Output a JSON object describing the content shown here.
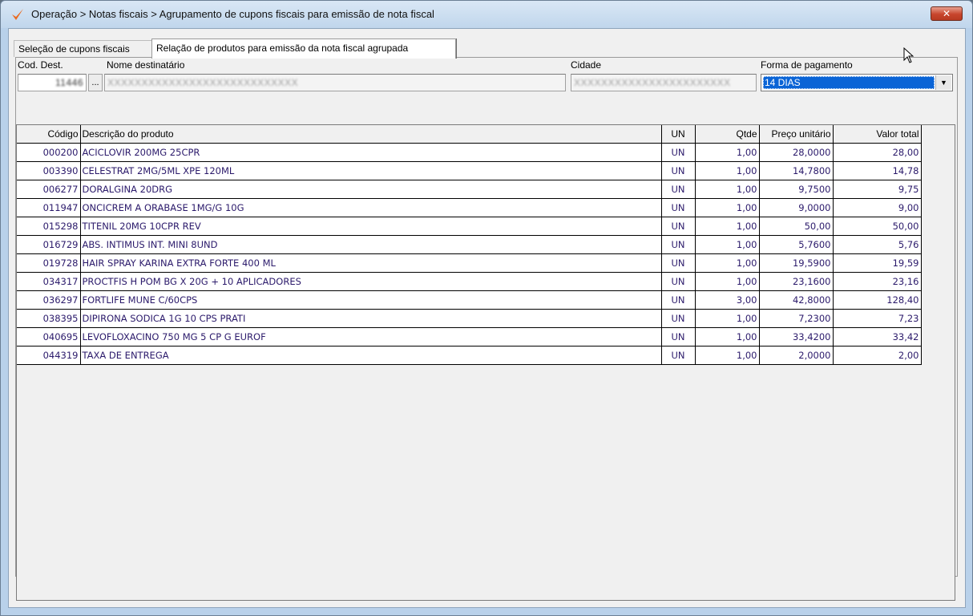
{
  "window": {
    "title": "Operação > Notas fiscais > Agrupamento de cupons fiscais para emissão de nota fiscal",
    "close_label": "✕"
  },
  "tabs": [
    {
      "label": "Seleção de cupons fiscais"
    },
    {
      "label": "Relação de produtos para emissão da nota fiscal agrupada"
    }
  ],
  "form": {
    "cod_dest_label": "Cod. Dest.",
    "cod_dest_value": "11446",
    "nome_label": "Nome destinatário",
    "nome_value": "XXXXXXXXXXXXXXXXXXXXXXXXXXXX",
    "lookup_label": "...",
    "cidade_label": "Cidade",
    "cidade_value": "XXXXXXXXXXXXXXXXXXXXXXX",
    "pagamento_label": "Forma de pagamento",
    "pagamento_value": "14 DIAS"
  },
  "table": {
    "headers": [
      "Código",
      "Descrição do produto",
      "UN",
      "Qtde",
      "Preço unitário",
      "Valor total"
    ],
    "rows": [
      [
        "000200",
        "ACICLOVIR 200MG 25CPR",
        "UN",
        "1,00",
        "28,0000",
        "28,00"
      ],
      [
        "003390",
        "CELESTRAT 2MG/5ML XPE 120ML",
        "UN",
        "1,00",
        "14,7800",
        "14,78"
      ],
      [
        "006277",
        "DORALGINA 20DRG",
        "UN",
        "1,00",
        "9,7500",
        "9,75"
      ],
      [
        "011947",
        "ONCICREM A ORABASE 1MG/G 10G",
        "UN",
        "1,00",
        "9,0000",
        "9,00"
      ],
      [
        "015298",
        "TITENIL 20MG 10CPR REV",
        "UN",
        "1,00",
        "50,00",
        "50,00"
      ],
      [
        "016729",
        "ABS. INTIMUS INT. MINI 8UND",
        "UN",
        "1,00",
        "5,7600",
        "5,76"
      ],
      [
        "019728",
        "HAIR SPRAY KARINA EXTRA FORTE 400 ML",
        "UN",
        "1,00",
        "19,5900",
        "19,59"
      ],
      [
        "034317",
        "PROCTFIS H POM BG X 20G + 10 APLICADORES",
        "UN",
        "1,00",
        "23,1600",
        "23,16"
      ],
      [
        "036297",
        "FORTLIFE MUNE C/60CPS",
        "UN",
        "3,00",
        "42,8000",
        "128,40"
      ],
      [
        "038395",
        "DIPIRONA SODICA 1G 10 CPS PRATI",
        "UN",
        "1,00",
        "7,2300",
        "7,23"
      ],
      [
        "040695",
        "LEVOFLOXACINO 750 MG 5 CP G EUROF",
        "UN",
        "1,00",
        "33,4200",
        "33,42"
      ],
      [
        "044319",
        "TAXA DE ENTREGA",
        "UN",
        "1,00",
        "2,0000",
        "2,00"
      ]
    ]
  },
  "colors": {
    "titlebar": "#c0d6ec",
    "selection": "#0a64d6",
    "cell_text": "#2b1a6b",
    "close": "#c7452c"
  },
  "icons": {
    "app": "check-mark-icon",
    "close": "close-icon",
    "dropdown": "chevron-down-icon",
    "cursor": "mouse-pointer-icon"
  }
}
